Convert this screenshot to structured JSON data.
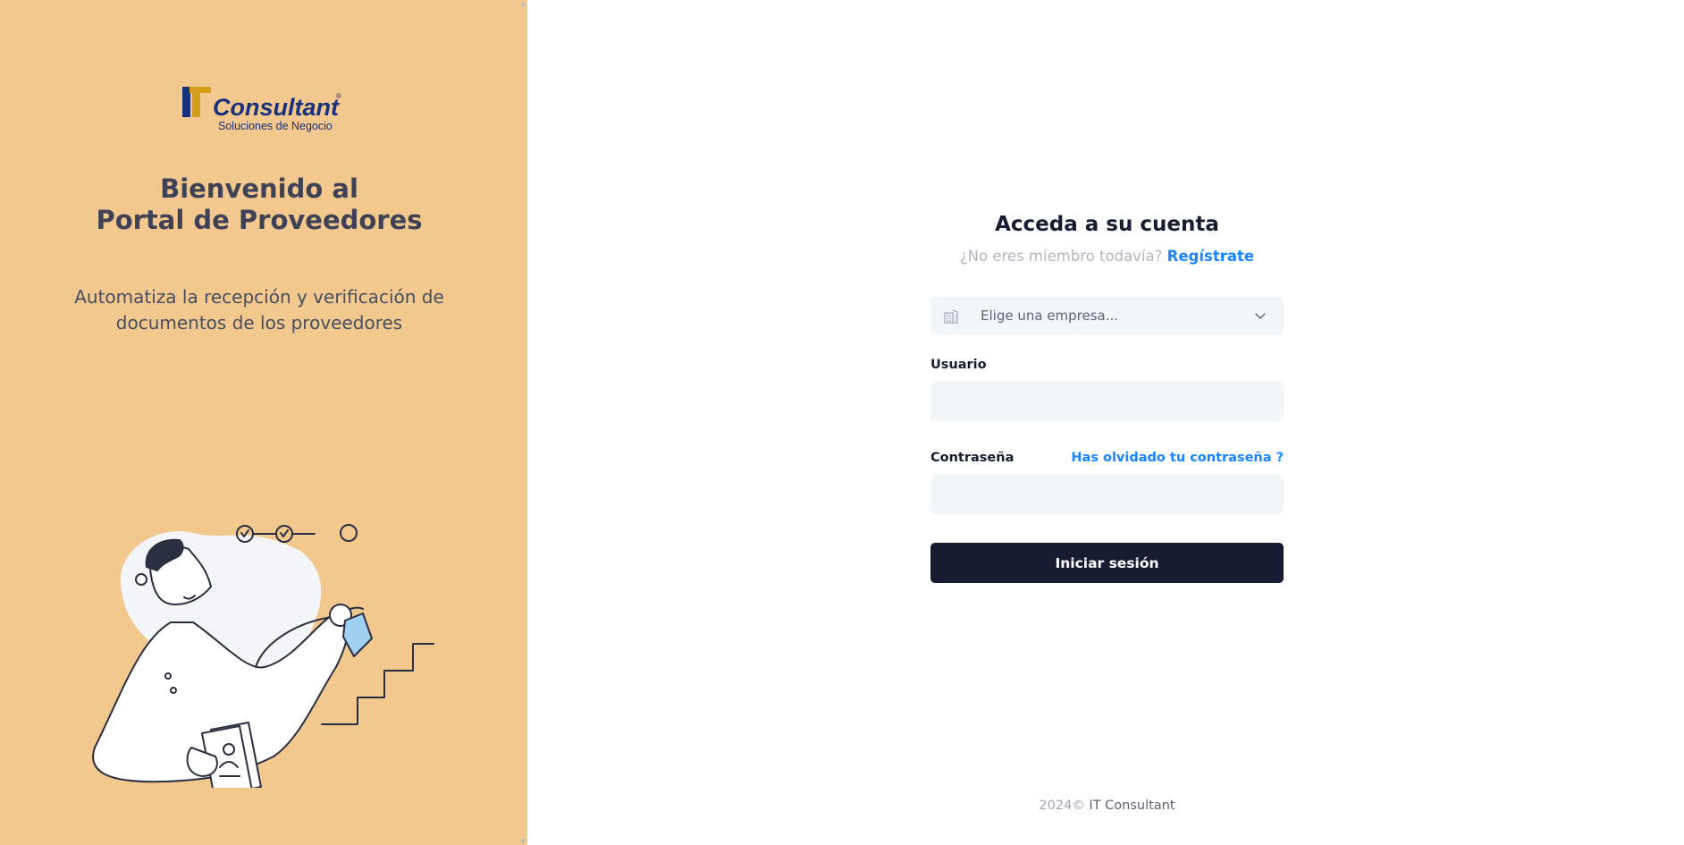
{
  "brand": {
    "logo_wordmark": "Consultant",
    "logo_tagline": "Soluciones de Negocio",
    "logo_mark": "IT"
  },
  "left_panel": {
    "welcome_line1": "Bienvenido al",
    "welcome_line2": "Portal de Proveedores",
    "tagline_line1": "Automatiza la recepción y verificación de",
    "tagline_line2": "documentos de los proveedores",
    "illustration": "person-climbing-stairs-with-documents",
    "background_color": "#f2c88e"
  },
  "login": {
    "title": "Acceda a su cuenta",
    "not_member_text": "¿No eres miembro todavía?",
    "register_link": "Regístrate",
    "company_select": {
      "icon": "building-icon",
      "selected": "Elige una empresa..."
    },
    "username_label": "Usuario",
    "username_value": "",
    "password_label": "Contraseña",
    "password_value": "",
    "forgot_link": "Has olvidado tu contraseña ?",
    "submit_label": "Iniciar sesión"
  },
  "footer": {
    "year": "2024©",
    "company": "IT Consultant"
  },
  "colors": {
    "accent_link": "#1b84ff",
    "primary_button": "#181c32",
    "input_background": "#f3f6f9"
  }
}
